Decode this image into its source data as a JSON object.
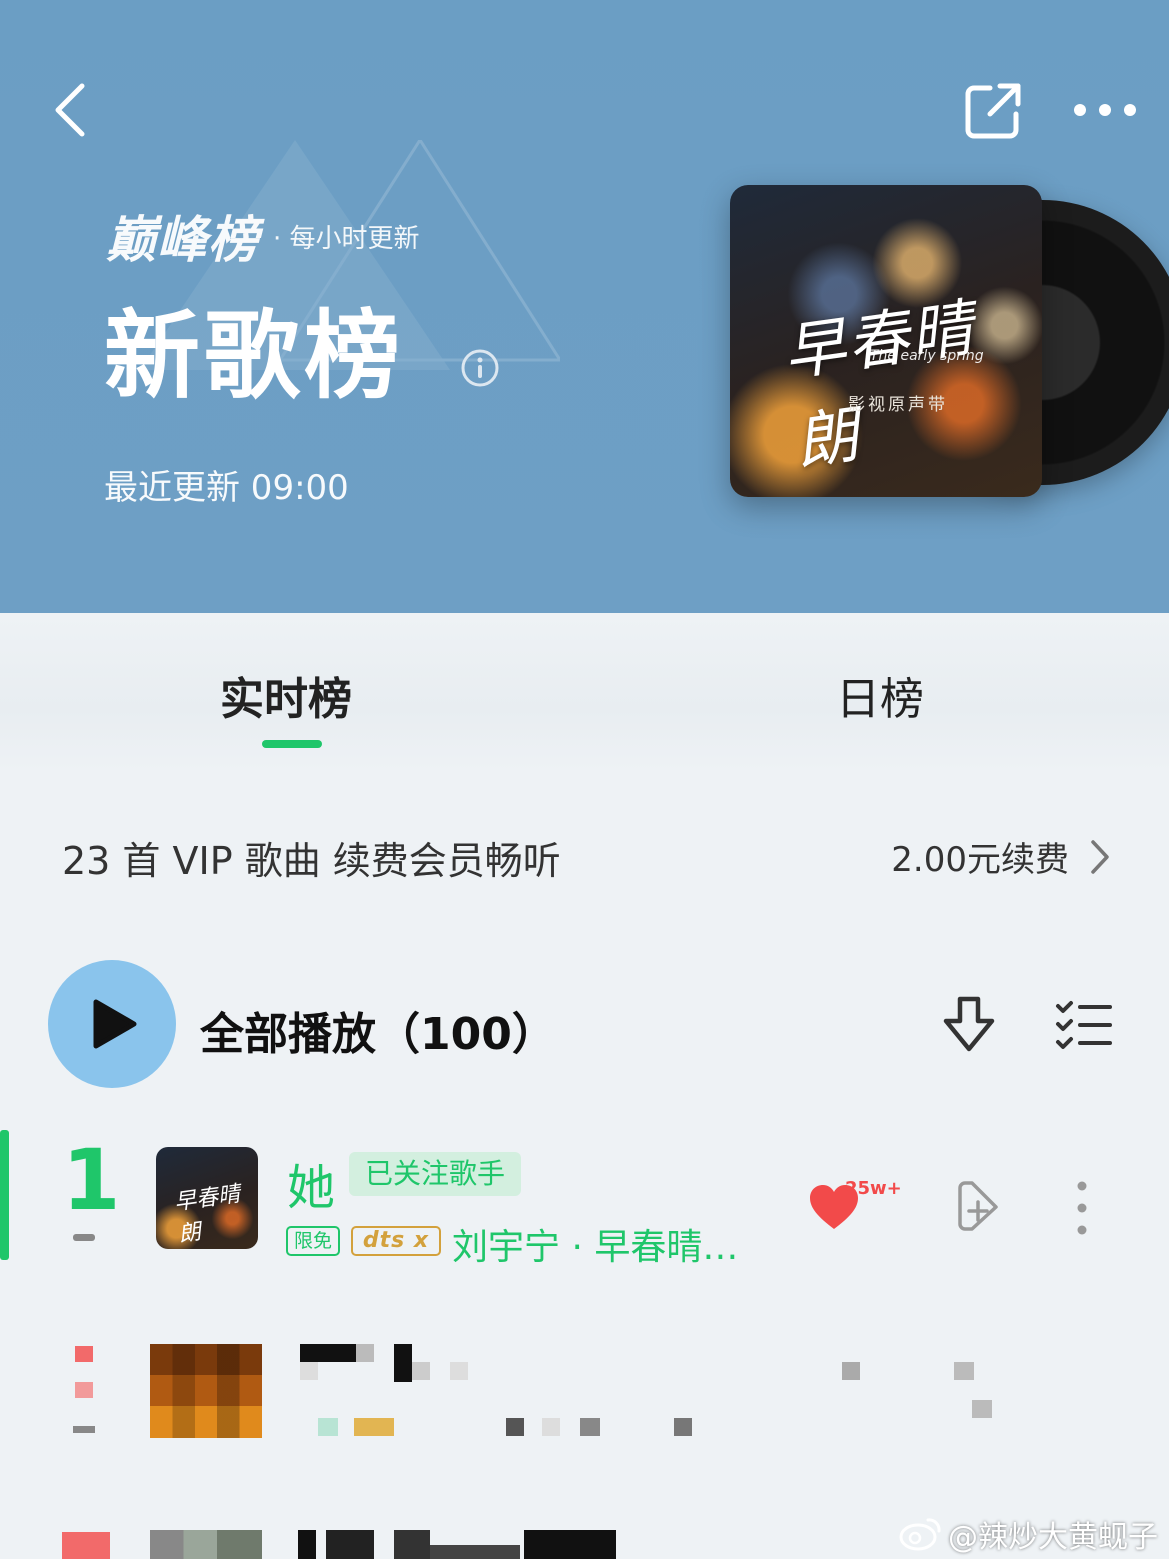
{
  "header": {
    "brand": "巅峰榜",
    "brand_sub": "· 每小时更新",
    "title": "新歌榜",
    "update_text": "最近更新 09:00",
    "icons": [
      "back-arrow-icon",
      "share-icon",
      "more-icon",
      "info-icon"
    ],
    "cover": {
      "title": "早春晴朗",
      "subtitle": "The early spring",
      "tag": "影视原声带"
    }
  },
  "tabs": [
    {
      "label": "实时榜",
      "active": true
    },
    {
      "label": "日榜",
      "active": false
    }
  ],
  "vip_banner": {
    "text": "23 首 VIP 歌曲 续费会员畅听",
    "action": "2.00元续费"
  },
  "play_all": {
    "label": "全部播放（100）",
    "icons": [
      "play-icon",
      "download-icon",
      "multi-select-icon"
    ]
  },
  "songs": [
    {
      "rank": "1",
      "title": "她",
      "badge": "已关注歌手",
      "tag_free": "限免",
      "tag_quality": "dts x",
      "meta": "刘宇宁 · 早春晴…",
      "likes": "25w+",
      "playing": true
    }
  ],
  "watermark": "@辣炒大黄蚬子",
  "colors": {
    "accent_green": "#1fc66a",
    "header_blue": "#6b9ec4",
    "play_button": "#8ac4ec",
    "heart_red": "#f24a4a",
    "dts_gold": "#d3a13c"
  }
}
